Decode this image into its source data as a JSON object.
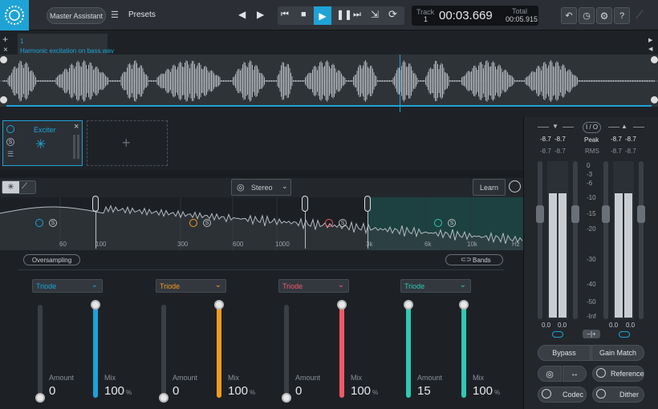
{
  "toolbar": {
    "master_assistant": "Master Assistant",
    "presets": "Presets",
    "track_label": "Track",
    "track_number": "1",
    "time": "00:03.669",
    "total_label": "Total",
    "total_time": "00:05.915"
  },
  "file_tab": {
    "index": "1",
    "name": "Harmonic excitation on bass.wav"
  },
  "module": {
    "name": "Exciter"
  },
  "spectrum": {
    "stereo_label": "Stereo",
    "learn_label": "Learn",
    "freq_labels": [
      "60",
      "100",
      "300",
      "600",
      "1000",
      "3k",
      "6k",
      "10k",
      "Hz"
    ]
  },
  "controls": {
    "oversampling": "Oversampling",
    "bands": "Bands"
  },
  "bands": [
    {
      "mode": "Triode",
      "color": "#1aa3d9",
      "amount_label": "Amount",
      "amount": "0",
      "mix_label": "Mix",
      "mix": "100",
      "mix_unit": "%",
      "mix_fraction": 1.0,
      "amount_fraction": 0
    },
    {
      "mode": "Triode",
      "color": "#f29c1f",
      "amount_label": "Amount",
      "amount": "0",
      "mix_label": "Mix",
      "mix": "100",
      "mix_unit": "%",
      "mix_fraction": 1.0,
      "amount_fraction": 0
    },
    {
      "mode": "Triode",
      "color": "#f05a66",
      "amount_label": "Amount",
      "amount": "0",
      "mix_label": "Mix",
      "mix": "100",
      "mix_unit": "%",
      "mix_fraction": 1.0,
      "amount_fraction": 0
    },
    {
      "mode": "Triode",
      "color": "#2ec9b4",
      "amount_label": "Amount",
      "amount": "15",
      "mix_label": "Mix",
      "mix": "100",
      "mix_unit": "%",
      "mix_fraction": 1.0,
      "amount_fraction": 1.0
    }
  ],
  "meters": {
    "io_label": "I / O",
    "peak_label": "Peak",
    "rms_label": "RMS",
    "in_peak_l": "-8.7",
    "in_peak_r": "-8.7",
    "in_rms_l": "-8.7",
    "in_rms_r": "-8.7",
    "out_peak_l": "-8.7",
    "out_peak_r": "-8.7",
    "out_rms_l": "-8.7",
    "out_rms_r": "-8.7",
    "scale": [
      "0",
      "-3",
      "-6",
      "-10",
      "-15",
      "-20",
      "-30",
      "-40",
      "-50",
      "-Inf"
    ],
    "in_gain_l": "0.0",
    "in_gain_r": "0.0",
    "out_gain_l": "0.0",
    "out_gain_r": "0.0",
    "bypass": "Bypass",
    "gain_match": "Gain Match",
    "reference": "Reference",
    "codec": "Codec",
    "dither": "Dither"
  }
}
